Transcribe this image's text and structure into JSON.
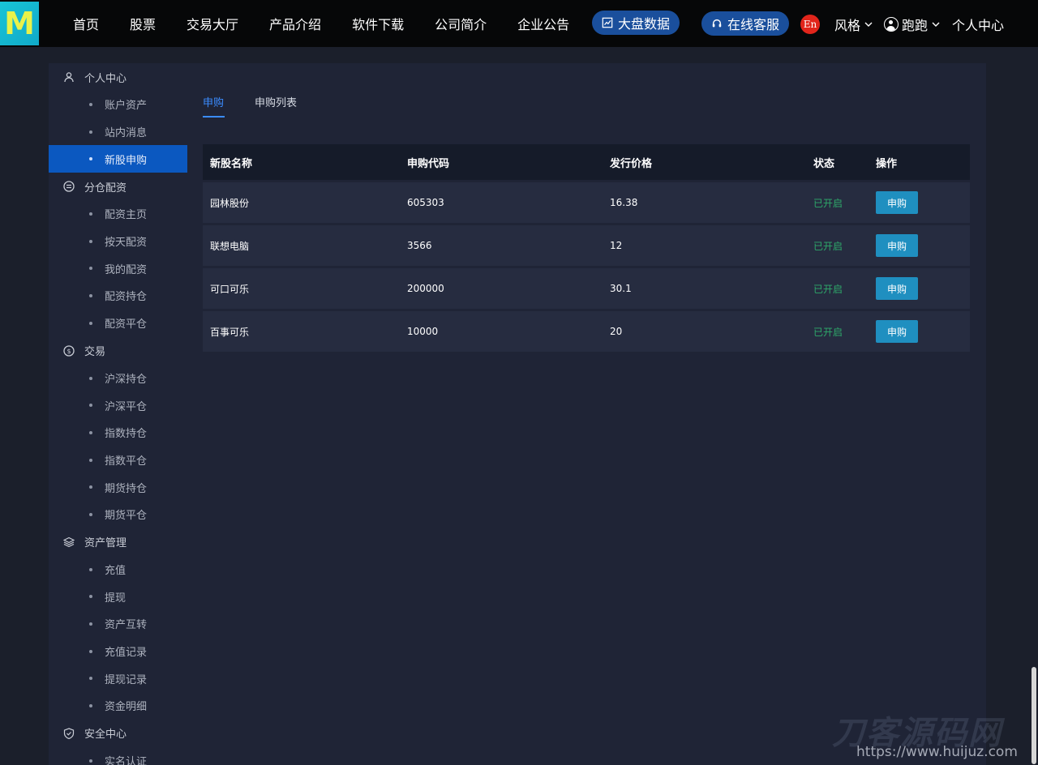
{
  "header": {
    "logo_letter": "M",
    "nav": [
      "首页",
      "股票",
      "交易大厅",
      "产品介绍",
      "软件下载",
      "公司简介",
      "企业公告"
    ],
    "market_data_label": "大盘数据",
    "online_service_label": "在线客服",
    "lang_badge": "En",
    "style_label": "风格",
    "user_name": "跑跑",
    "personal_center_label": "个人中心"
  },
  "sidebar": {
    "groups": [
      {
        "title": "个人中心",
        "icon": "user-icon",
        "items": [
          "账户资产",
          "站内消息",
          "新股申购"
        ]
      },
      {
        "title": "分仓配资",
        "icon": "swap-circle-icon",
        "items": [
          "配资主页",
          "按天配资",
          "我的配资",
          "配资持仓",
          "配资平仓"
        ]
      },
      {
        "title": "交易",
        "icon": "dollar-circle-icon",
        "items": [
          "沪深持仓",
          "沪深平仓",
          "指数持仓",
          "指数平仓",
          "期货持仓",
          "期货平仓"
        ]
      },
      {
        "title": "资产管理",
        "icon": "layers-icon",
        "items": [
          "充值",
          "提现",
          "资产互转",
          "充值记录",
          "提现记录",
          "资金明细"
        ]
      },
      {
        "title": "安全中心",
        "icon": "shield-icon",
        "items": [
          "实名认证"
        ]
      }
    ],
    "active_item": "新股申购"
  },
  "tabs": [
    {
      "label": "申购",
      "active": true
    },
    {
      "label": "申购列表",
      "active": false
    }
  ],
  "table": {
    "columns": [
      "新股名称",
      "申购代码",
      "发行价格",
      "状态",
      "操作"
    ],
    "rows": [
      {
        "name": "园林股份",
        "code": "605303",
        "price": "16.38",
        "status": "已开启",
        "action": "申购"
      },
      {
        "name": "联想电脑",
        "code": "3566",
        "price": "12",
        "status": "已开启",
        "action": "申购"
      },
      {
        "name": "可口可乐",
        "code": "200000",
        "price": "30.1",
        "status": "已开启",
        "action": "申购"
      },
      {
        "name": "百事可乐",
        "code": "10000",
        "price": "20",
        "status": "已开启",
        "action": "申购"
      }
    ]
  },
  "watermark": {
    "logo_text": "刀客源码网",
    "url": "https://www.huijuz.com"
  },
  "colors": {
    "accent": "#3b8cff",
    "active_bg": "#0b58c0",
    "status_green": "#2ea86a",
    "button_blue": "#1f8fc0",
    "pill_blue": "#1a4f9c"
  }
}
